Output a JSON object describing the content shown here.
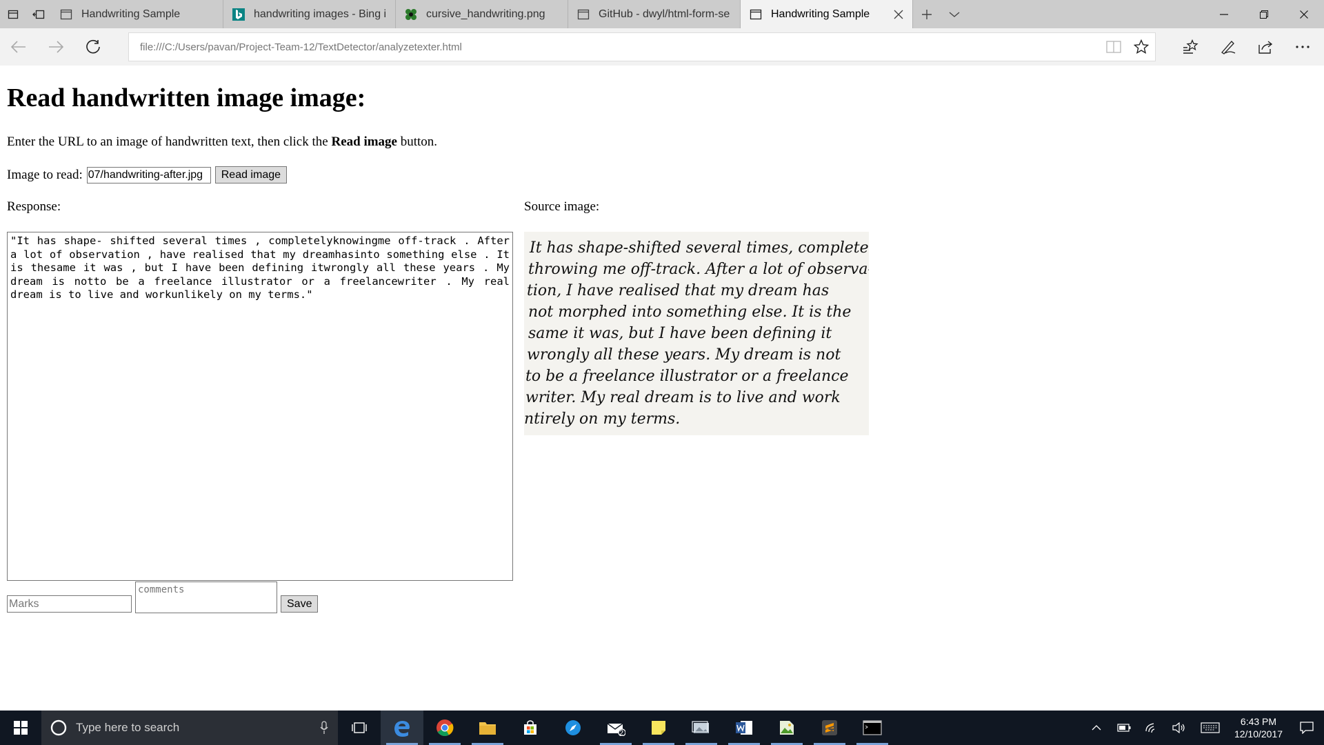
{
  "browser": {
    "tabs": [
      {
        "title": "Handwriting Sample",
        "icon": "page-icon",
        "active": false
      },
      {
        "title": "handwriting images - Bing i",
        "icon": "bing-icon",
        "active": false
      },
      {
        "title": "cursive_handwriting.png",
        "icon": "image-tab-icon",
        "active": false
      },
      {
        "title": "GitHub - dwyl/html-form-se",
        "icon": "page-icon",
        "active": false
      },
      {
        "title": "Handwriting Sample",
        "icon": "page-icon",
        "active": true
      }
    ],
    "address": "file:///C:/Users/pavan/Project-Team-12/TextDetector/analyzetexter.html"
  },
  "page": {
    "title": "Read handwritten image image:",
    "intro_before": "Enter the URL to an image of handwritten text, then click the ",
    "intro_bold": "Read image",
    "intro_after": " button.",
    "image_label": "Image to read:",
    "image_value": "07/handwriting-after.jpg",
    "read_button": "Read image",
    "response_label": "Response:",
    "source_label": "Source image:",
    "response_text": "\"It has shape- shifted several times , completelyknowingme off-track . After a lot of observation , have realised that my dreamhasinto something else . It is thesame it was , but I have been defining itwrongly all these years . My dream is notto be a freelance illustrator or a freelancewriter . My real dream is to live and workunlikely on my terms.\"",
    "marks_placeholder": "Marks",
    "comments_placeholder": "comments",
    "save_button": "Save"
  },
  "source_image": {
    "lines": [
      "It has shape-shifted several times, completely",
      "throwing me off-track. After a lot of observa-",
      "tion, I have realised that my dream has",
      "not morphed into something else. It is the",
      "same it was, but I have been defining it",
      "wrongly all these years. My dream is not",
      "to be a freelance illustrator or a freelance",
      "writer. My real dream is to live and work",
      "ntirely on my terms."
    ]
  },
  "taskbar": {
    "search_placeholder": "Type here to search",
    "mail_badge": "2",
    "time": "6:43 PM",
    "date": "12/10/2017"
  },
  "colors": {
    "taskbar_bg": "#101722",
    "edge_blue": "#1e73c8",
    "tab_strip": "#cccccc"
  }
}
